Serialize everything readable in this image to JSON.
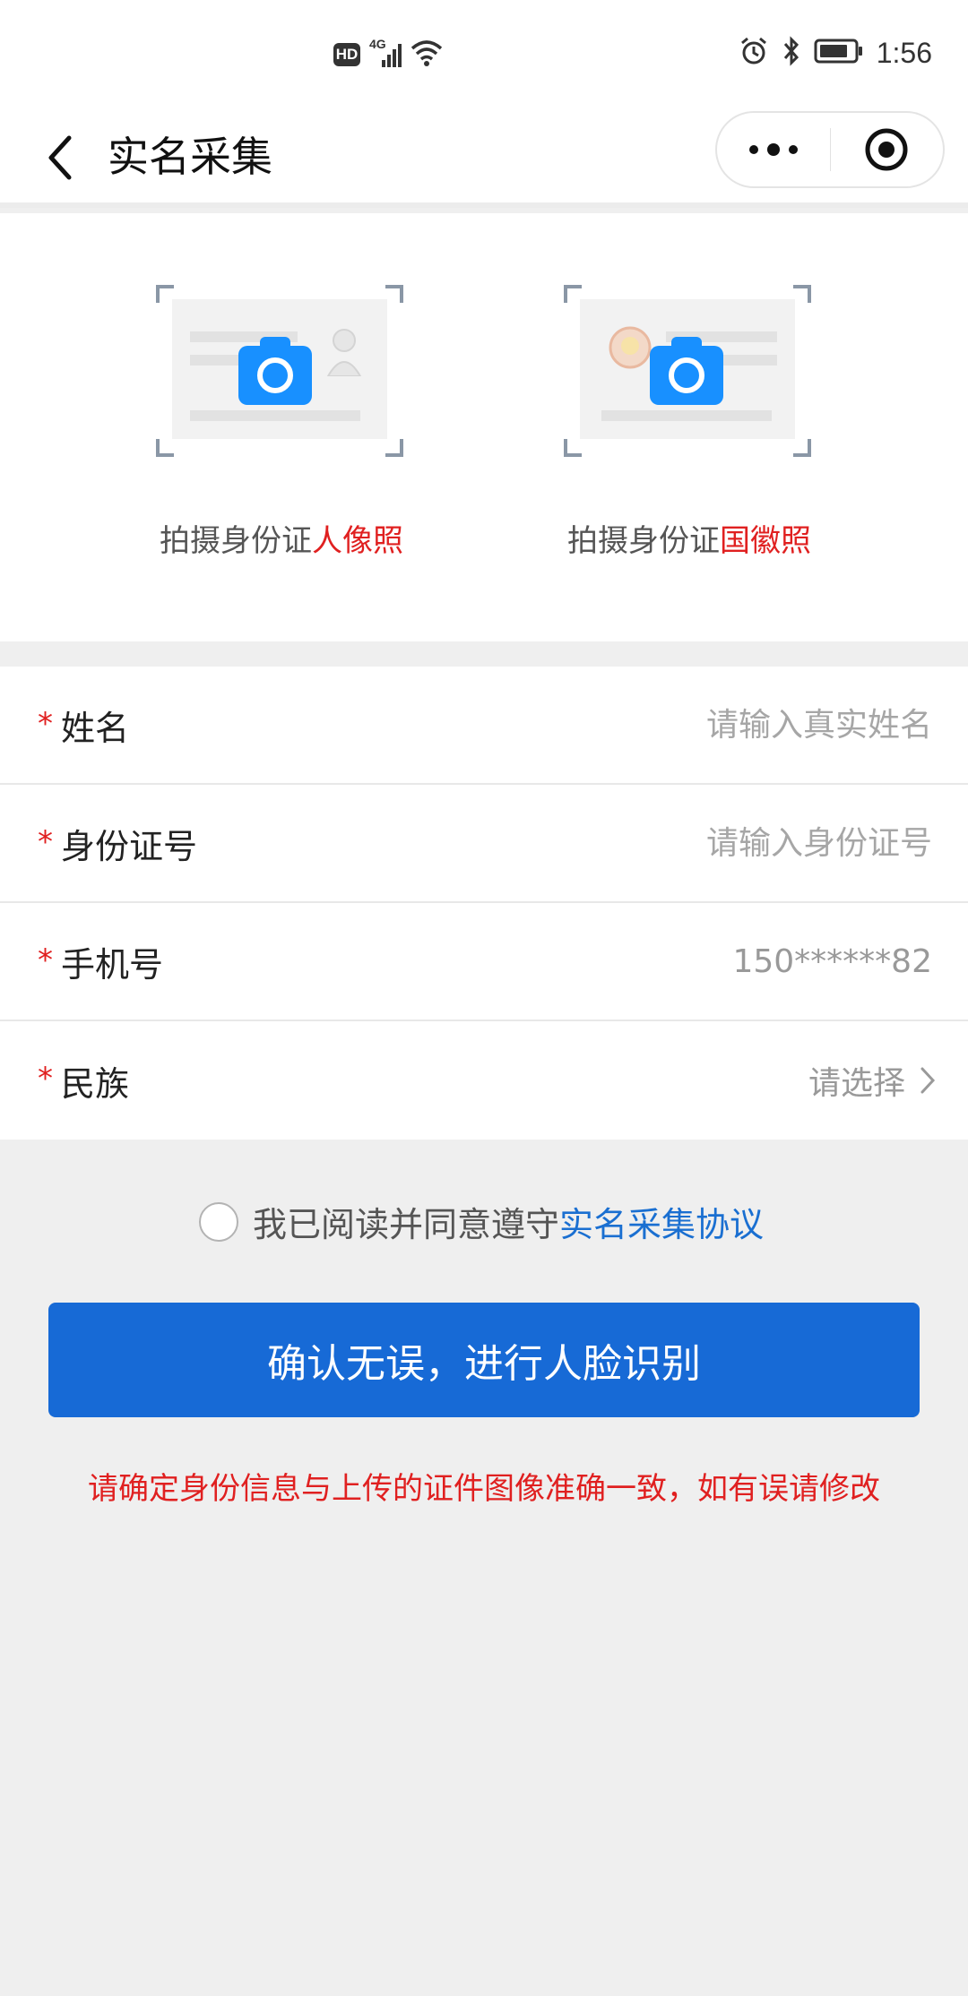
{
  "status_bar": {
    "hd_label": "HD",
    "network_label": "4G",
    "time": "1:56"
  },
  "nav": {
    "title": "实名采集"
  },
  "upload": {
    "front": {
      "label_prefix": "拍摄身份证",
      "label_highlight": "人像照"
    },
    "back": {
      "label_prefix": "拍摄身份证",
      "label_highlight": "国徽照"
    }
  },
  "form": {
    "required_mark": "*",
    "name": {
      "label": "姓名",
      "placeholder": "请输入真实姓名"
    },
    "id_number": {
      "label": "身份证号",
      "placeholder": "请输入身份证号"
    },
    "phone": {
      "label": "手机号",
      "value": "150******82"
    },
    "ethnicity": {
      "label": "民族",
      "value": "请选择"
    }
  },
  "agreement": {
    "text": "我已阅读并同意遵守",
    "link": "实名采集协议"
  },
  "confirm_button": "确认无误，进行人脸识别",
  "warning": "请确定身份信息与上传的证件图像准确一致，如有误请修改",
  "colors": {
    "primary": "#176ad6",
    "accent_blue": "#1890ff",
    "danger": "#e02020",
    "link": "#1a6fd1"
  }
}
